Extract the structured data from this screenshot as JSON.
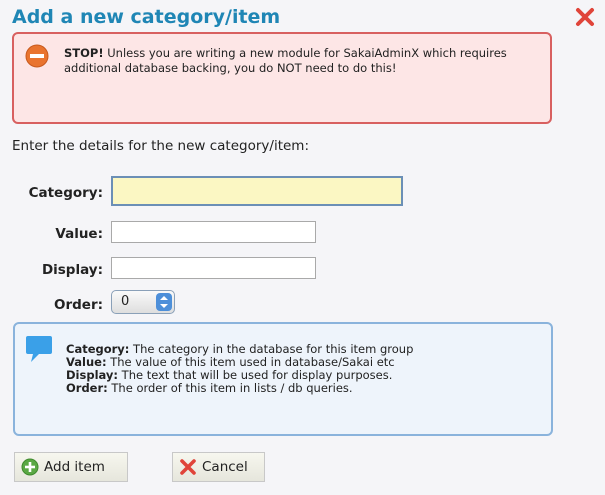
{
  "dialog": {
    "title": "Add a new category/item"
  },
  "warning": {
    "strong": "STOP!",
    "message": " Unless you are writing a new module for SakaiAdminX which requires additional database backing, you do NOT need to do this!"
  },
  "form": {
    "intro": "Enter the details for the new category/item:",
    "category_label": "Category:",
    "category_value": "",
    "value_label": "Value:",
    "value_value": "",
    "display_label": "Display:",
    "display_value": "",
    "order_label": "Order:",
    "order_value": "0"
  },
  "help": {
    "rows": [
      {
        "term": "Category:",
        "desc": " The category in the database for this item group"
      },
      {
        "term": "Value:",
        "desc": " The value of this item used in database/Sakai etc"
      },
      {
        "term": "Display:",
        "desc": " The text that will be used for display purposes."
      },
      {
        "term": "Order:",
        "desc": " The order of this item in lists / db queries."
      }
    ]
  },
  "buttons": {
    "add_label": "Add item",
    "cancel_label": "Cancel"
  },
  "icons": {
    "close": "close-icon",
    "stop": "stop-icon",
    "help": "speech-bubble-icon",
    "add": "add-circle-icon",
    "cancel": "cancel-x-icon"
  },
  "colors": {
    "title": "#1f86b5",
    "warning_border": "#d86060",
    "warning_bg": "#fde6e6",
    "help_border": "#8ab3dc",
    "help_bg": "#eef4fb",
    "focused_field_bg": "#fbf7c3",
    "close_x": "#e0443a"
  }
}
